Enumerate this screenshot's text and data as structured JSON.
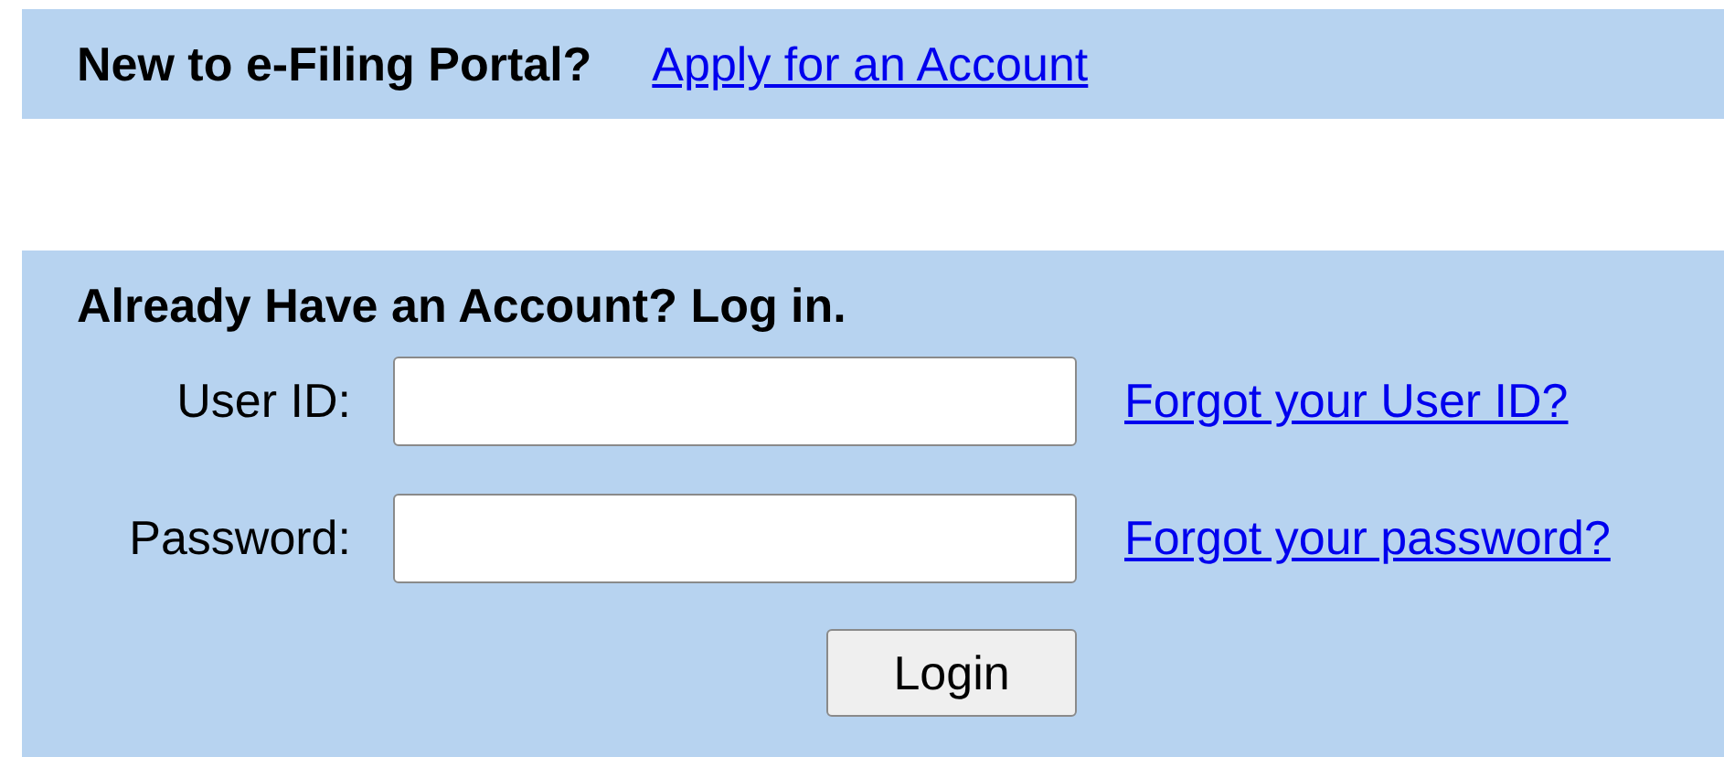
{
  "signup": {
    "prompt": "New to e-Filing Portal?",
    "link": "Apply for an Account"
  },
  "login": {
    "heading": "Already Have an Account? Log in.",
    "fields": [
      {
        "label": "User ID:",
        "link": "Forgot your User ID?"
      },
      {
        "label": "Password:",
        "link": "Forgot your password?"
      }
    ],
    "button": "Login"
  }
}
